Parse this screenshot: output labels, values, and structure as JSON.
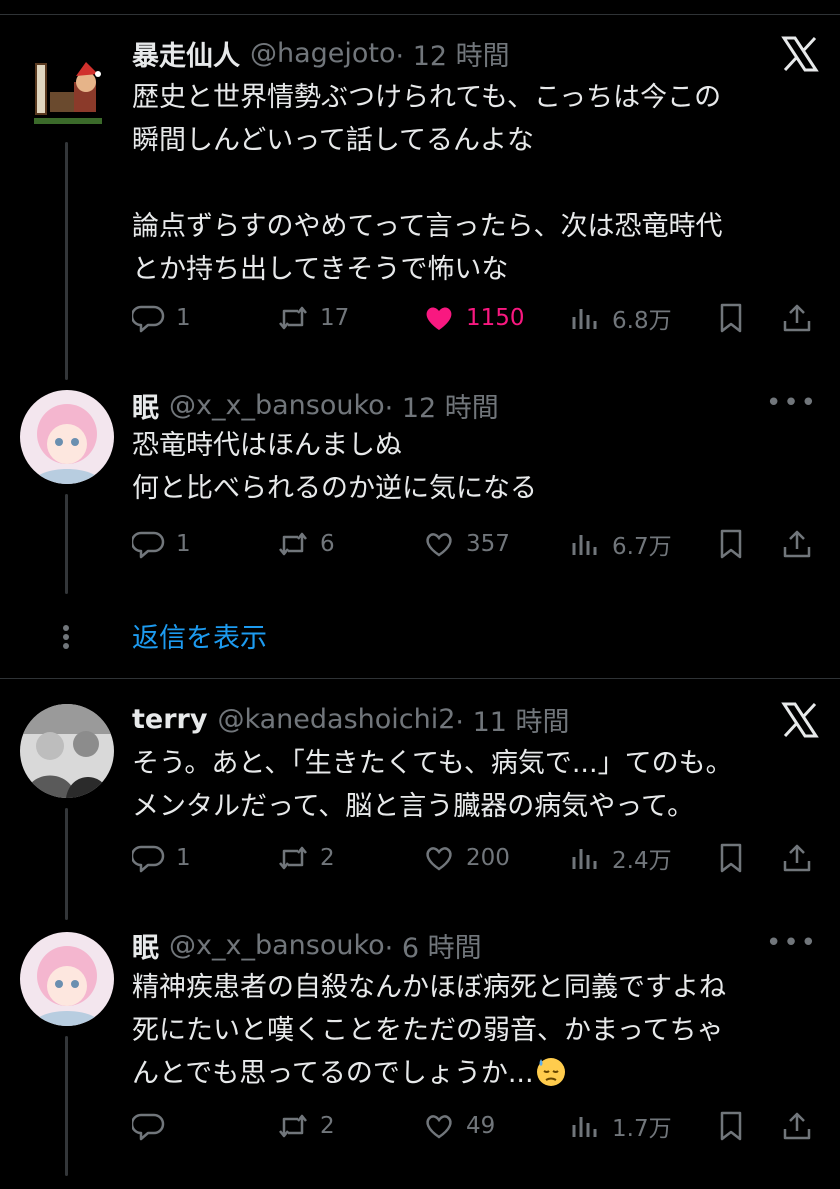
{
  "tweets": [
    {
      "name": "暴走仙人",
      "handle": "@hagejoto",
      "time": "· 12 時間",
      "text": "歴史と世界情勢ぶつけられても、こっちは今この\n瞬間しんどいって話してるんよな\n\n論点ずらすのやめてって言ったら、次は恐竜時代\nとか持ち出してきそうで怖いな",
      "replies": "1",
      "retweets": "17",
      "likes": "1150",
      "views": "6.8万",
      "liked": true,
      "corner": "x-logo"
    },
    {
      "name": "眠",
      "handle": "@x_x_bansouko",
      "time": "· 12 時間",
      "text": "恐竜時代はほんましぬ\n何と比べられるのか逆に気になる",
      "replies": "1",
      "retweets": "6",
      "likes": "357",
      "views": "6.7万",
      "liked": false,
      "corner": "more"
    },
    {
      "name": "terry",
      "handle": "@kanedashoichi2",
      "time": "· 11 時間",
      "text": "そう。あと、「生きたくても、病気で...」てのも。\nメンタルだって、脳と言う臓器の病気やって。",
      "replies": "1",
      "retweets": "2",
      "likes": "200",
      "views": "2.4万",
      "liked": false,
      "corner": "x-logo"
    },
    {
      "name": "眠",
      "handle": "@x_x_bansouko",
      "time": "· 6 時間",
      "text": "精神疾患者の自殺なんかほぼ病死と同義ですよね\n死にたいと嘆くことをただの弱音、かまってちゃ\nんとでも思ってるのでしょうか...",
      "emoji": "downcast-sweat-face",
      "replies": "",
      "retweets": "2",
      "likes": "49",
      "views": "1.7万",
      "liked": false,
      "corner": "more"
    }
  ],
  "show_replies_label": "返信を表示",
  "colors": {
    "like": "#f91880",
    "link": "#1d9bf0",
    "muted": "#71767b",
    "text": "#e7e9ea"
  },
  "icons": [
    "reply-icon",
    "retweet-icon",
    "like-icon",
    "views-icon",
    "bookmark-icon",
    "share-icon",
    "x-logo-icon",
    "more-icon"
  ]
}
